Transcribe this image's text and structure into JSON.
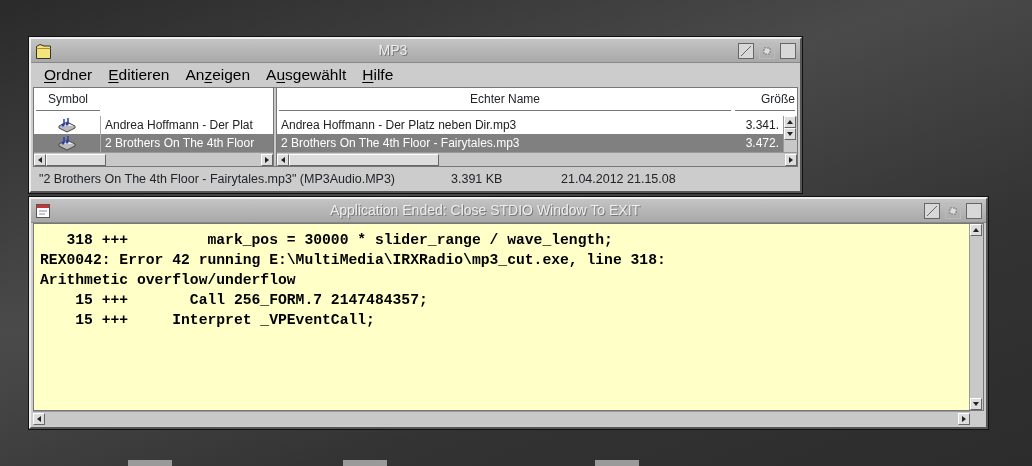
{
  "folder_window": {
    "title": "MP3",
    "menu": [
      {
        "key": "O",
        "after": "rdner"
      },
      {
        "key": "E",
        "after": "ditieren"
      },
      {
        "before": "An",
        "key": "z",
        "after": "eigen"
      },
      {
        "before": "A",
        "key": "u",
        "after": "sgewählt"
      },
      {
        "key": "H",
        "after": "ilfe"
      }
    ],
    "table": {
      "columns": [
        {
          "label": "Symbol"
        },
        {
          "label": "Echter Name"
        },
        {
          "label": "Größe"
        }
      ],
      "rows": [
        {
          "selected": false,
          "title": "Andrea Hoffmann - Der Plat",
          "real_name": "Andrea Hoffmann - Der Platz neben Dir.mp3",
          "size": "3.341."
        },
        {
          "selected": true,
          "title": "2 Brothers On The 4th Floor",
          "real_name": "2 Brothers On The 4th Floor - Fairytales.mp3",
          "size": "3.472."
        }
      ]
    },
    "status": [
      "\"2 Brothers On The 4th Floor - Fairytales.mp3\" (MP3Audio.MP3)",
      "3.391 KB",
      "21.04.2012 21.15.08"
    ]
  },
  "stdio_window": {
    "title": "Application Ended: Close STDIO Window To EXIT",
    "lines": [
      "   318 +++         mark_pos = 30000 * slider_range / wave_length;",
      "REX0042: Error 42 running E:\\MultiMedia\\IRXRadio\\mp3_cut.exe, line 318:",
      "Arithmetic overflow/underflow",
      "    15 +++       Call 256_FORM.7 2147484357;",
      "    15 +++     Interpret _VPEventCall;"
    ]
  }
}
